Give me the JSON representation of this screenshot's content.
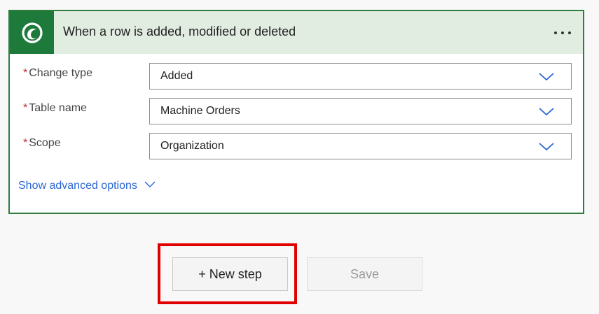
{
  "trigger": {
    "title": "When a row is added, modified or deleted",
    "icon": "dataverse-icon",
    "menu_icon": "more-options-icon",
    "accent_color": "#1e7a3a",
    "header_bg": "#e2ede2"
  },
  "fields": [
    {
      "required_mark": "*",
      "label": "Change type",
      "value": "Added"
    },
    {
      "required_mark": "*",
      "label": "Table name",
      "value": "Machine Orders"
    },
    {
      "required_mark": "*",
      "label": "Scope",
      "value": "Organization"
    }
  ],
  "advanced": {
    "label": "Show advanced options"
  },
  "actions": {
    "new_step_label": "+ New step",
    "save_label": "Save"
  },
  "highlight_color": "#e00000"
}
